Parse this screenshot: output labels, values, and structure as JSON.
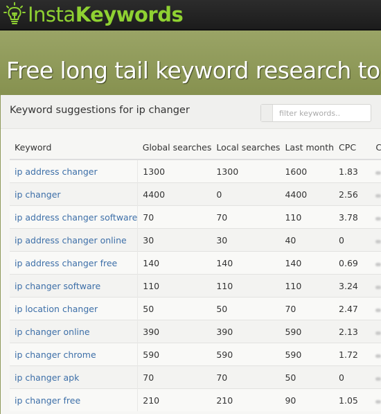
{
  "header": {
    "logo_icon": "lightbulb-icon",
    "logo_text_light": "Insta",
    "logo_text_bold": "Keywords",
    "brand_color": "#8fd132"
  },
  "hero": {
    "title": "Free long tail keyword research tool"
  },
  "panel": {
    "title": "Keyword suggestions for ip changer",
    "filter_placeholder": "filter keywords.."
  },
  "table": {
    "columns": [
      "Keyword",
      "Global searches",
      "Local searches",
      "Last month",
      "CPC",
      "Co"
    ],
    "rows": [
      {
        "keyword": "ip address changer",
        "global": "1300",
        "local": "1300",
        "last_month": "1600",
        "cpc": "1.83"
      },
      {
        "keyword": "ip changer",
        "global": "4400",
        "local": "0",
        "last_month": "4400",
        "cpc": "2.56"
      },
      {
        "keyword": "ip address changer software",
        "global": "70",
        "local": "70",
        "last_month": "110",
        "cpc": "3.78"
      },
      {
        "keyword": "ip address changer online",
        "global": "30",
        "local": "30",
        "last_month": "40",
        "cpc": "0"
      },
      {
        "keyword": "ip address changer free",
        "global": "140",
        "local": "140",
        "last_month": "140",
        "cpc": "0.69"
      },
      {
        "keyword": "ip changer software",
        "global": "110",
        "local": "110",
        "last_month": "110",
        "cpc": "3.24"
      },
      {
        "keyword": "ip location changer",
        "global": "50",
        "local": "50",
        "last_month": "70",
        "cpc": "2.47"
      },
      {
        "keyword": "ip changer online",
        "global": "390",
        "local": "390",
        "last_month": "590",
        "cpc": "2.13"
      },
      {
        "keyword": "ip changer chrome",
        "global": "590",
        "local": "590",
        "last_month": "590",
        "cpc": "1.72"
      },
      {
        "keyword": "ip changer apk",
        "global": "70",
        "local": "70",
        "last_month": "50",
        "cpc": "0"
      },
      {
        "keyword": "ip changer free",
        "global": "210",
        "local": "210",
        "last_month": "90",
        "cpc": "1.05"
      }
    ]
  }
}
